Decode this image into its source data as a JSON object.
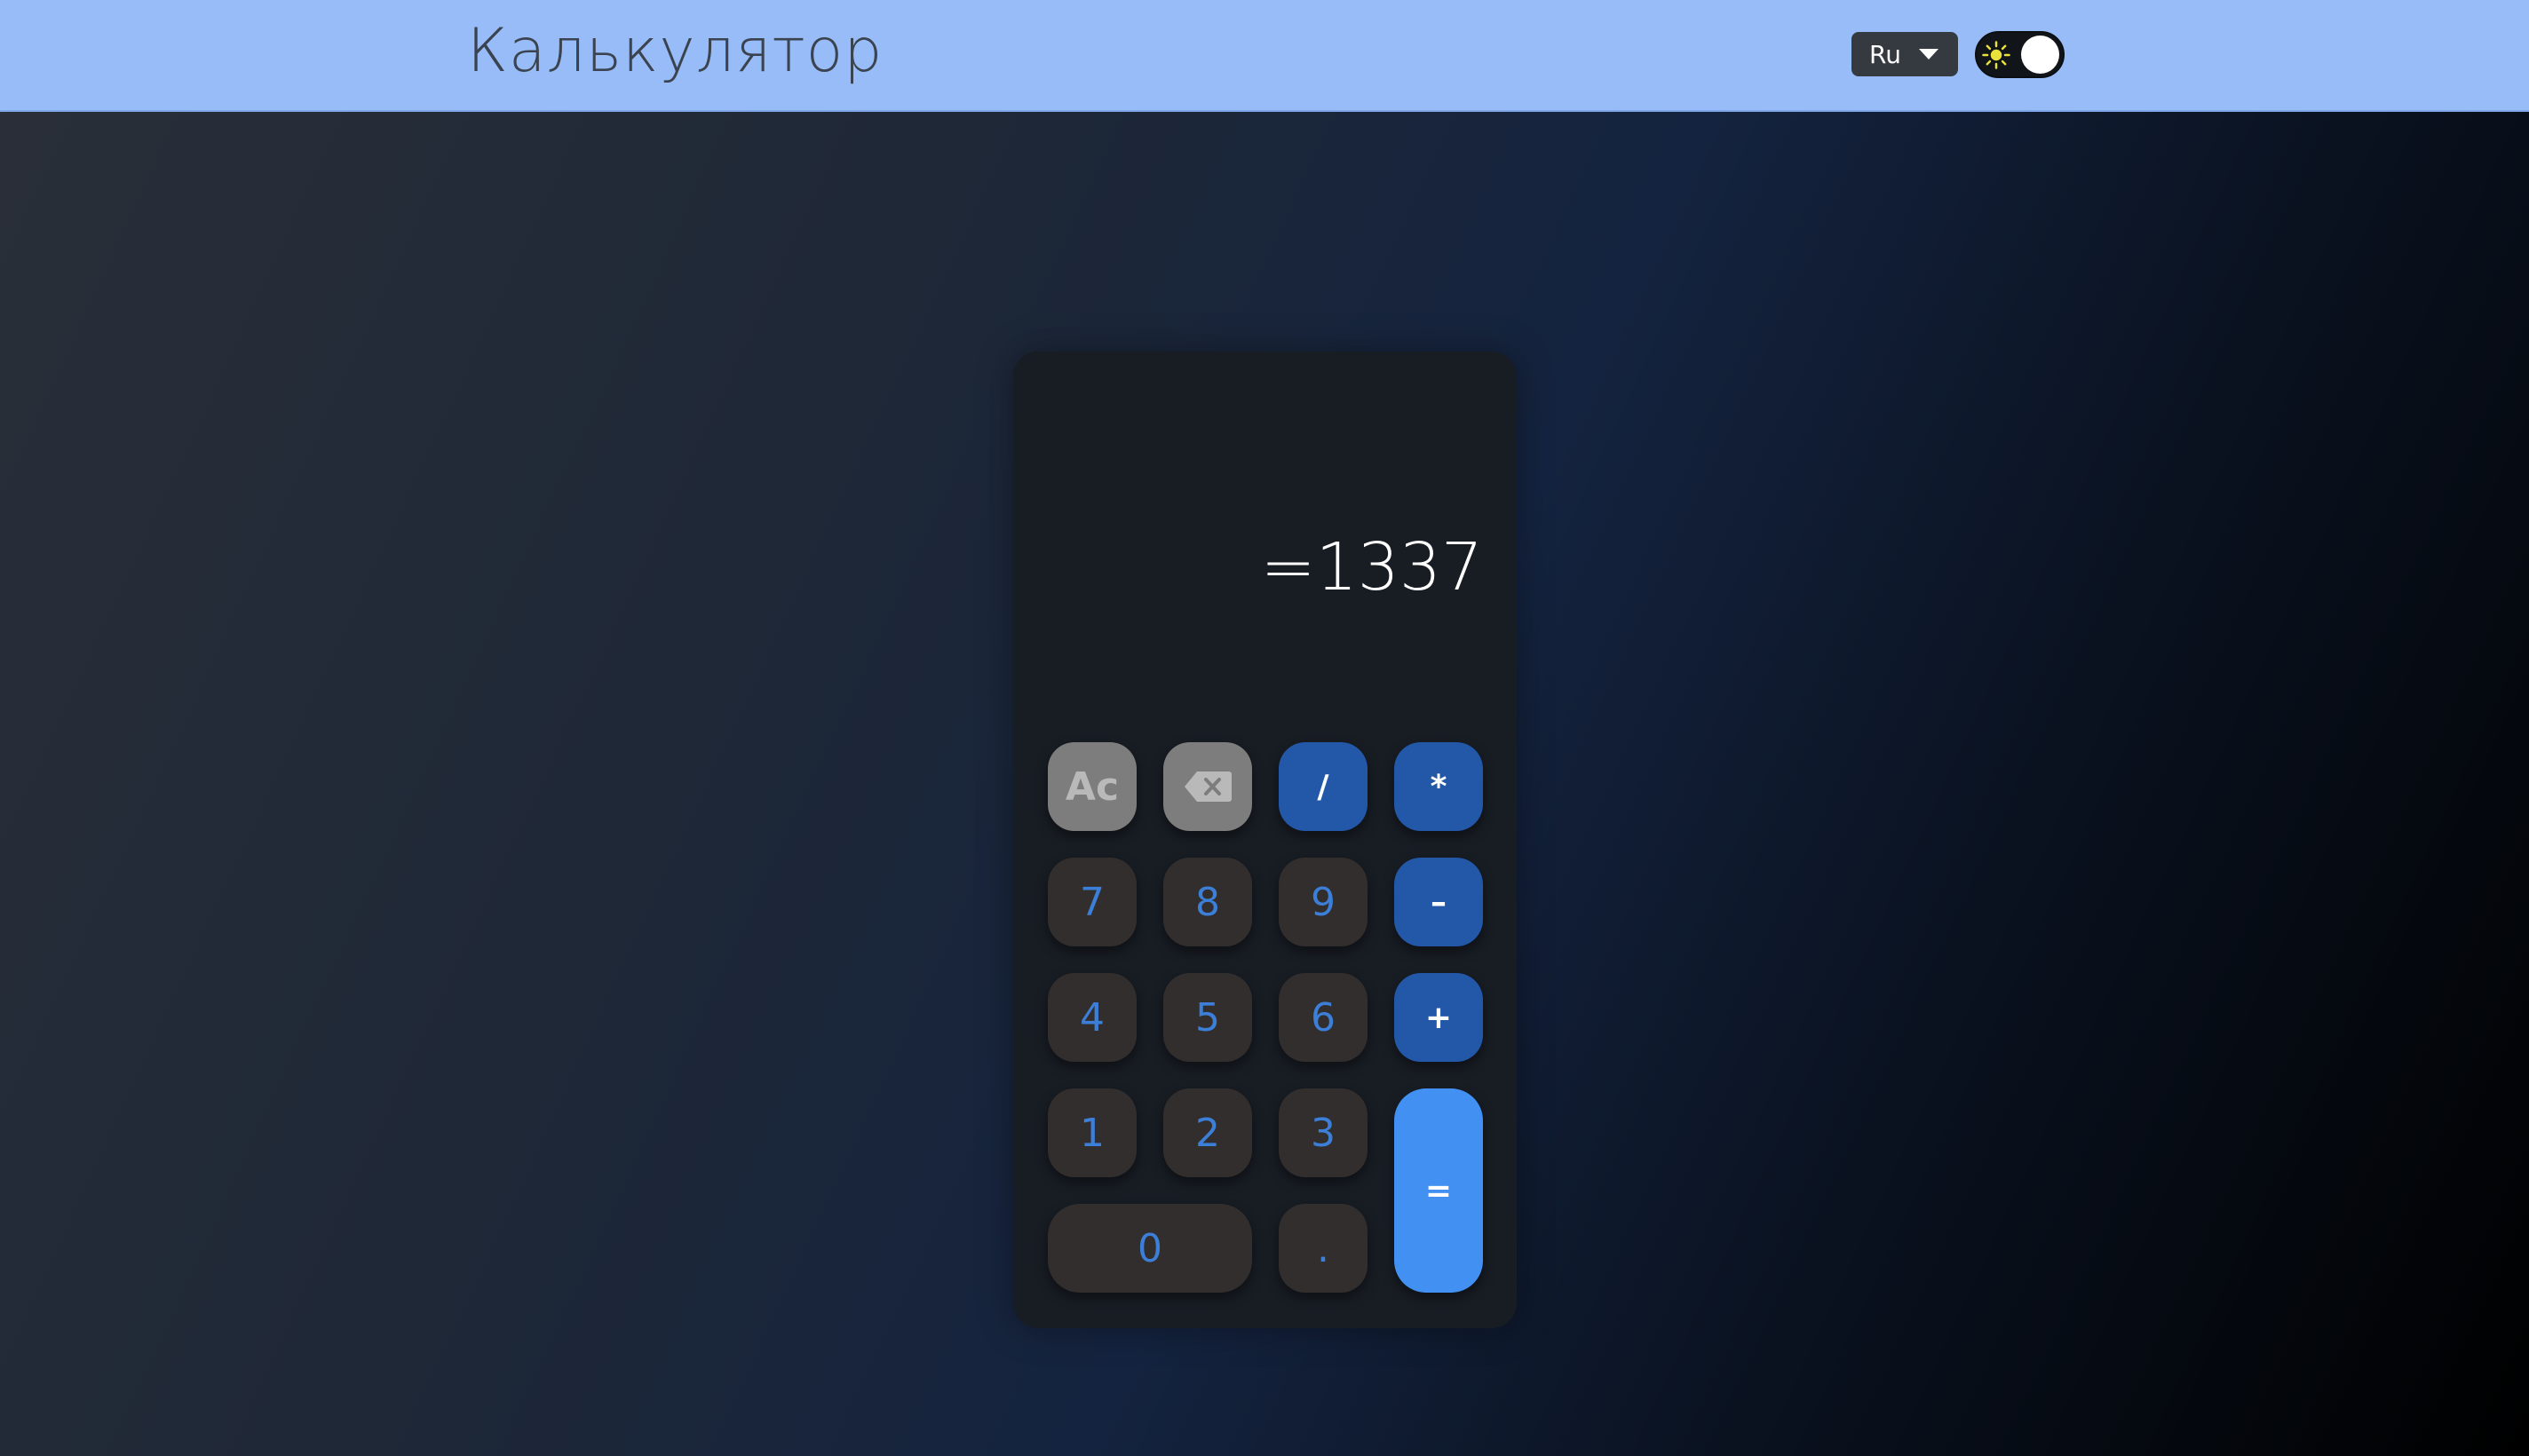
{
  "header": {
    "title": "Калькулятор",
    "language": "Ru",
    "theme_icon": "sun-icon"
  },
  "calculator": {
    "display": "=1337",
    "keys": {
      "clear": "Ac",
      "backspace_icon": "backspace-icon",
      "divide": "/",
      "multiply": "*",
      "seven": "7",
      "eight": "8",
      "nine": "9",
      "minus": "–",
      "four": "4",
      "five": "5",
      "six": "6",
      "plus": "+",
      "one": "1",
      "two": "2",
      "three": "3",
      "equals": "=",
      "zero": "0",
      "dot": "."
    }
  },
  "colors": {
    "header_bg": "#97bcf7",
    "number_key_text": "#3c7fd8",
    "operator_key_bg": "#2357a8",
    "equals_key_bg": "#4190f2",
    "function_key_bg": "#7d7d7d"
  }
}
